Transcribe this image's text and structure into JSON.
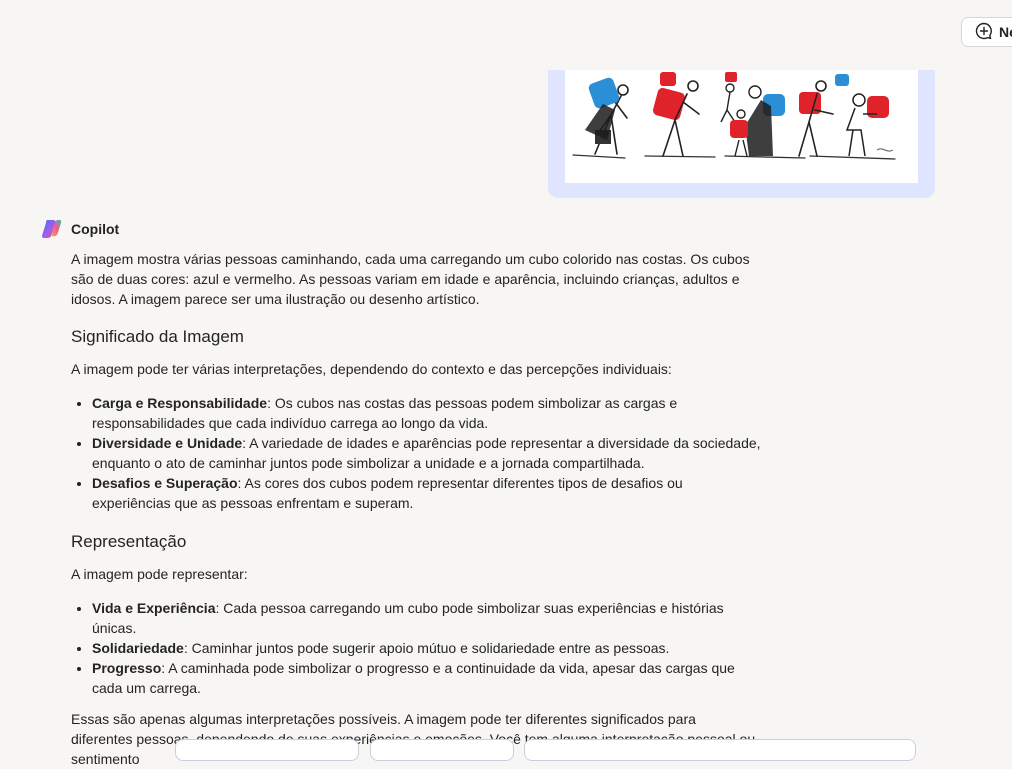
{
  "header": {
    "new_chat_label": "Ne",
    "new_chat_icon": "chat-plus-icon"
  },
  "user_image": {
    "icon": "people-carrying-cubes-illustration"
  },
  "copilot": {
    "name": "Copilot",
    "logo_icon": "copilot-logo-icon"
  },
  "response": {
    "intro": "A imagem mostra várias pessoas caminhando, cada uma carregando um cubo colorido nas costas. Os cubos são de duas cores: azul e vermelho. As pessoas variam em idade e aparência, incluindo crianças, adultos e idosos. A imagem parece ser uma ilustração ou desenho artístico.",
    "section1": {
      "title": "Significado da Imagem",
      "lead": "A imagem pode ter várias interpretações, dependendo do contexto e das percepções individuais:",
      "items": [
        {
          "term": "Carga e Responsabilidade",
          "text": ": Os cubos nas costas das pessoas podem simbolizar as cargas e responsabilidades que cada indivíduo carrega ao longo da vida."
        },
        {
          "term": "Diversidade e Unidade",
          "text": ": A variedade de idades e aparências pode representar a diversidade da sociedade, enquanto o ato de caminhar juntos pode simbolizar a unidade e a jornada compartilhada."
        },
        {
          "term": "Desafios e Superação",
          "text": ": As cores dos cubos podem representar diferentes tipos de desafios ou experiências que as pessoas enfrentam e superam."
        }
      ]
    },
    "section2": {
      "title": "Representação",
      "lead": "A imagem pode representar:",
      "items": [
        {
          "term": "Vida e Experiência",
          "text": ": Cada pessoa carregando um cubo pode simbolizar suas experiências e histórias únicas."
        },
        {
          "term": "Solidariedade",
          "text": ": Caminhar juntos pode sugerir apoio mútuo e solidariedade entre as pessoas."
        },
        {
          "term": "Progresso",
          "text": ": A caminhada pode simbolizar o progresso e a continuidade da vida, apesar das cargas que cada um carrega."
        }
      ]
    },
    "closing": "Essas são apenas algumas interpretações possíveis. A imagem pode ter diferentes significados para diferentes pessoas, dependendo de suas experiências e emoções. Você tem alguma interpretação pessoal ou sentimento"
  },
  "colors": {
    "background": "#f7f6f4",
    "image_card": "#dfe5ff",
    "cube_blue": "#2a8fd6",
    "cube_red": "#e0222b"
  }
}
